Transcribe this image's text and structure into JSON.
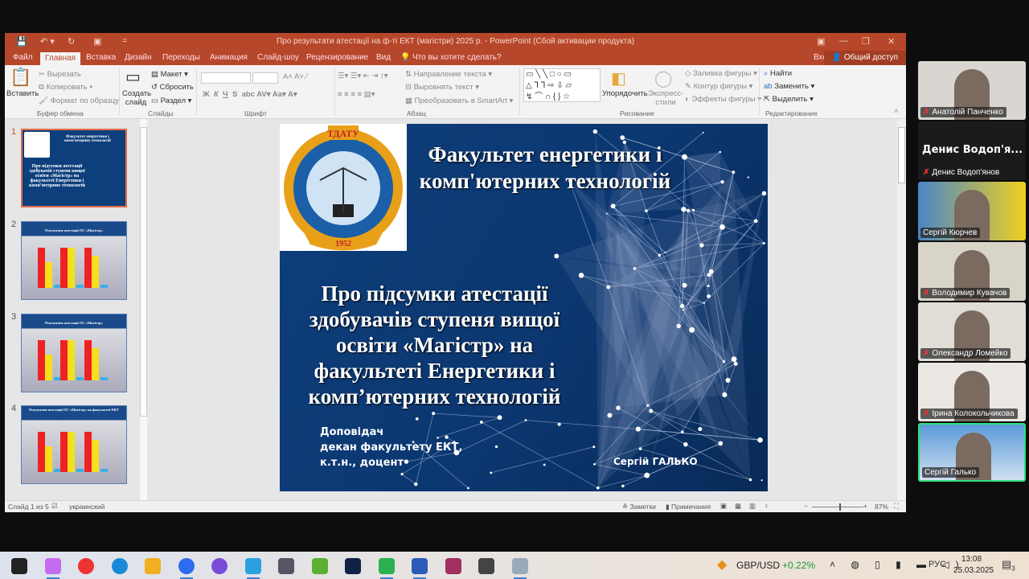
{
  "window": {
    "title": "Про результати атестації на ф-ті ЕКТ (магістри) 2025 р. - PowerPoint (Сбой активации продукта)"
  },
  "tabs": [
    "Файл",
    "Главная",
    "Вставка",
    "Дизайн",
    "Переходы",
    "Анимация",
    "Слайд-шоу",
    "Рецензирование",
    "Вид"
  ],
  "active_tab": "Главная",
  "tell_me": "Что вы хотите сделать?",
  "signin": "Вход",
  "share": "Общий доступ",
  "ribbon": {
    "clipboard": {
      "paste": "Вставить",
      "cut": "Вырезать",
      "copy": "Копировать",
      "format_painter": "Формат по образцу",
      "group": "Буфер обмена"
    },
    "slides": {
      "new_slide": "Создать слайд",
      "layout": "Макет",
      "reset": "Сбросить",
      "section": "Раздел",
      "group": "Слайды"
    },
    "font": {
      "group": "Шрифт",
      "bold": "Ж",
      "italic": "К",
      "underline": "Ч",
      "shadow": "S"
    },
    "paragraph": {
      "text_direction": "Направление текста",
      "align_text": "Выровнять текст",
      "smartart": "Преобразовать в SmartArt",
      "group": "Абзац"
    },
    "drawing": {
      "arrange": "Упорядочить",
      "quick_styles": "Экспресс-стили",
      "fill": "Заливка фигуры",
      "outline": "Контур фигуры",
      "effects": "Эффекты фигуры",
      "group": "Рисование"
    },
    "editing": {
      "find": "Найти",
      "replace": "Заменить",
      "select": "Выделить",
      "group": "Редактирование"
    }
  },
  "thumbnails": [
    {
      "num": "1",
      "title": "Факультет енергетики і комп'ютерних технологій"
    },
    {
      "num": "2",
      "title": "Результати атестації ОС «Магістр»"
    },
    {
      "num": "3",
      "title": "Результати атестації ОС «Магістр»"
    },
    {
      "num": "4",
      "title": "Результати атестації ОС «Магістр» на факультеті ЕКТ"
    }
  ],
  "slide": {
    "logo_text": "ТДАТУ 1952",
    "header": "Факультет енергетики і комп'ютерних технологій",
    "title": "Про підсумки атестації здобувачів ступеня вищої освіти «Магістр»  на факультеті Енергетики і комп’ютерних технологій",
    "speaker_lines": [
      "Доповідач",
      "декан факультету ЕКТ,",
      "к.т.н., доцент"
    ],
    "speaker_name": "Сергій ГАЛЬКО"
  },
  "status": {
    "slide": "Слайд 1 из 5",
    "language": "украинский",
    "notes": "Заметки",
    "comments": "Примечания",
    "zoom": "87%",
    "zoom_level": 87
  },
  "participants": [
    {
      "name": "Анатолій Панченко",
      "muted": true,
      "video": true
    },
    {
      "name": "Денис Водоп'янов",
      "display": "Денис Водоп'я...",
      "muted": true,
      "video": false
    },
    {
      "name": "Сергій Кюрчев",
      "muted": false,
      "video": true
    },
    {
      "name": "Володимир Кувачов",
      "muted": true,
      "video": true
    },
    {
      "name": "Олександр Ломейко",
      "muted": true,
      "video": true
    },
    {
      "name": "Ірина Колокольчикова",
      "muted": true,
      "video": true
    },
    {
      "name": "Сергій Галько",
      "muted": false,
      "video": true,
      "speaking": true
    }
  ],
  "taskbar": {
    "apps": [
      "start",
      "copilot",
      "chrome",
      "edge",
      "explorer",
      "zoom",
      "viber",
      "telegram",
      "calculator",
      "utorrent",
      "vpn",
      "whatsapp",
      "word",
      "winrar",
      "calendar",
      "photos"
    ],
    "ticker_label": "GBP/USD",
    "ticker_change": "+0.22%",
    "lang": "РУС",
    "time": "13:08",
    "date": "25.03.2025",
    "notifications": "3",
    "whatsapp_badge": "1"
  },
  "colors": {
    "accent": "#b7472a",
    "slide_bg": "#0d3f7c",
    "speaking": "#2ee07a",
    "ticker_up": "#1a9a3a"
  }
}
